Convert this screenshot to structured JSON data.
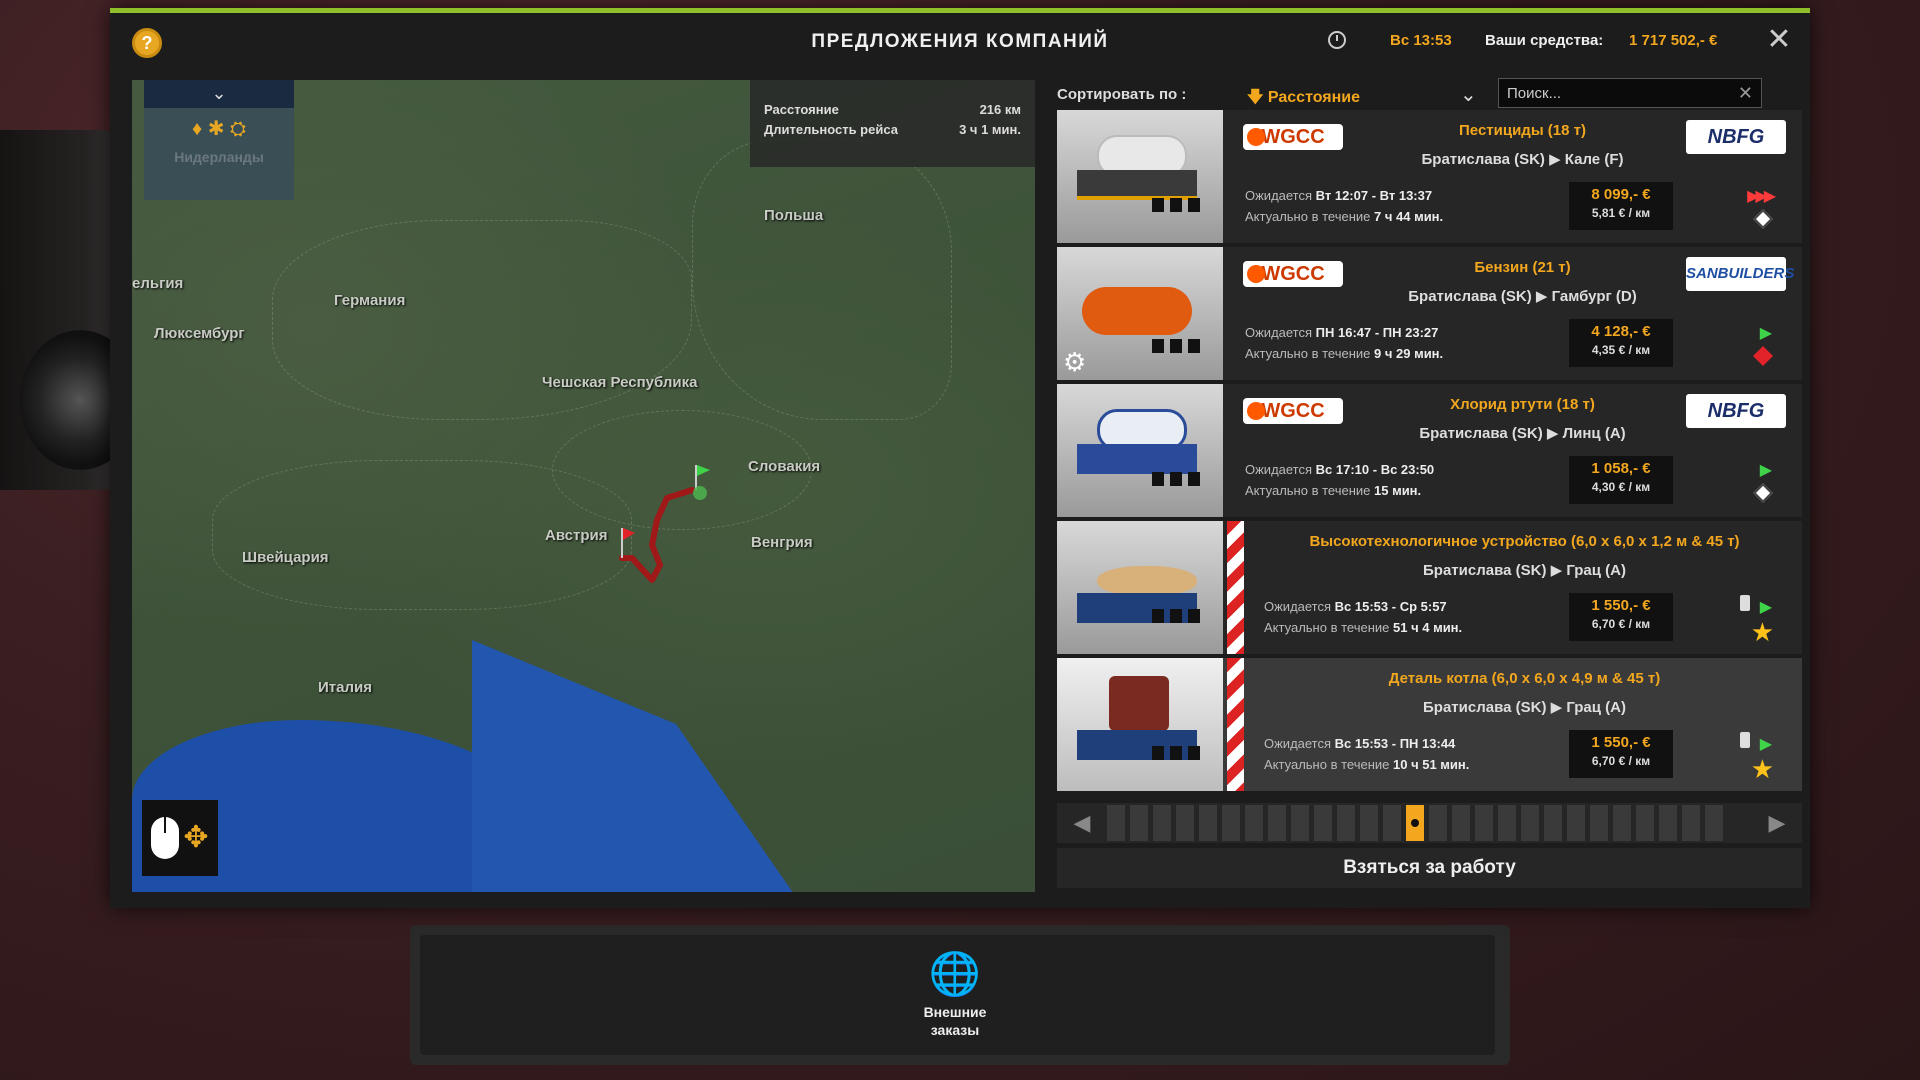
{
  "header": {
    "title": "ПРЕДЛОЖЕНИЯ КОМПАНИЙ",
    "time": "Вс 13:53",
    "funds_label": "Ваши средства:",
    "funds_value": "1 717 502,- €",
    "help_label": "?",
    "close_label": "✕"
  },
  "map": {
    "info": {
      "distance_label": "Расстояние",
      "distance_value": "216 км",
      "duration_label": "Длительность рейса",
      "duration_value": "3 ч 1 мин."
    },
    "filter_label": "Нидерланды",
    "labels": {
      "poland": "Польша",
      "germany": "Германия",
      "belgium": "ельгия",
      "luxembourg": "Люксембург",
      "czech": "Чешская Республика",
      "slovakia": "Словакия",
      "austria": "Австрия",
      "hungary": "Венгрия",
      "switzerland": "Швейцария",
      "italy": "Италия"
    }
  },
  "sort": {
    "label": "Сортировать по :",
    "selected": "Расстояние",
    "search_placeholder": "Поиск..."
  },
  "jobs": [
    {
      "source_company": "WGCC",
      "cargo": "Пестициды (18 т)",
      "route": "Братислава (SK) ▶ Кале (F)",
      "dest_company": "NBFG",
      "expected_label": "Ожидается",
      "expected_value": "Вт 12:07 - Вт 13:37",
      "valid_label": "Актуально в течение",
      "valid_value": "7 ч 44 мин.",
      "price": "8 099,- €",
      "per_km": "5,81 € / км"
    },
    {
      "source_company": "WGCC",
      "cargo": "Бензин (21 т)",
      "route": "Братислава (SK) ▶ Гамбург (D)",
      "dest_company": "SANBUILDERS",
      "expected_label": "Ожидается",
      "expected_value": "ПН 16:47 - ПН 23:27",
      "valid_label": "Актуально в течение",
      "valid_value": "9 ч 29 мин.",
      "price": "4 128,- €",
      "per_km": "4,35 € / км"
    },
    {
      "source_company": "WGCC",
      "cargo": "Хлорид ртути (18 т)",
      "route": "Братислава (SK) ▶ Линц (A)",
      "dest_company": "NBFG",
      "expected_label": "Ожидается",
      "expected_value": "Вс 17:10 - Вс 23:50",
      "valid_label": "Актуально в течение",
      "valid_value": "15 мин.",
      "price": "1 058,- €",
      "per_km": "4,30 € / км"
    },
    {
      "cargo": "Высокотехнологичное устройство (6,0 x 6,0 x 1,2 м & 45 т)",
      "route": "Братислава (SK) ▶ Грац (A)",
      "expected_label": "Ожидается",
      "expected_value": "Вс 15:53 - Ср 5:57",
      "valid_label": "Актуально в течение",
      "valid_value": "51 ч 4 мин.",
      "price": "1 550,- €",
      "per_km": "6,70 € / км"
    },
    {
      "cargo": "Деталь котла (6,0 x 6,0 x 4,9 м & 45 т)",
      "route": "Братислава (SK) ▶ Грац (A)",
      "expected_label": "Ожидается",
      "expected_value": "Вс 15:53 - ПН 13:44",
      "valid_label": "Актуально в течение",
      "valid_value": "10 ч 51 мин.",
      "price": "1 550,- €",
      "per_km": "6,70 € / км"
    }
  ],
  "pager": {
    "total": 27,
    "active_index": 13
  },
  "accept_button": "Взяться за работу",
  "external_orders": {
    "label_line1": "Внешние",
    "label_line2": "заказы"
  },
  "colors": {
    "accent": "#f2a71f",
    "top_bar": "#8fbf2a",
    "urgent": "#ff3a3a",
    "ok": "#3fd34a"
  }
}
